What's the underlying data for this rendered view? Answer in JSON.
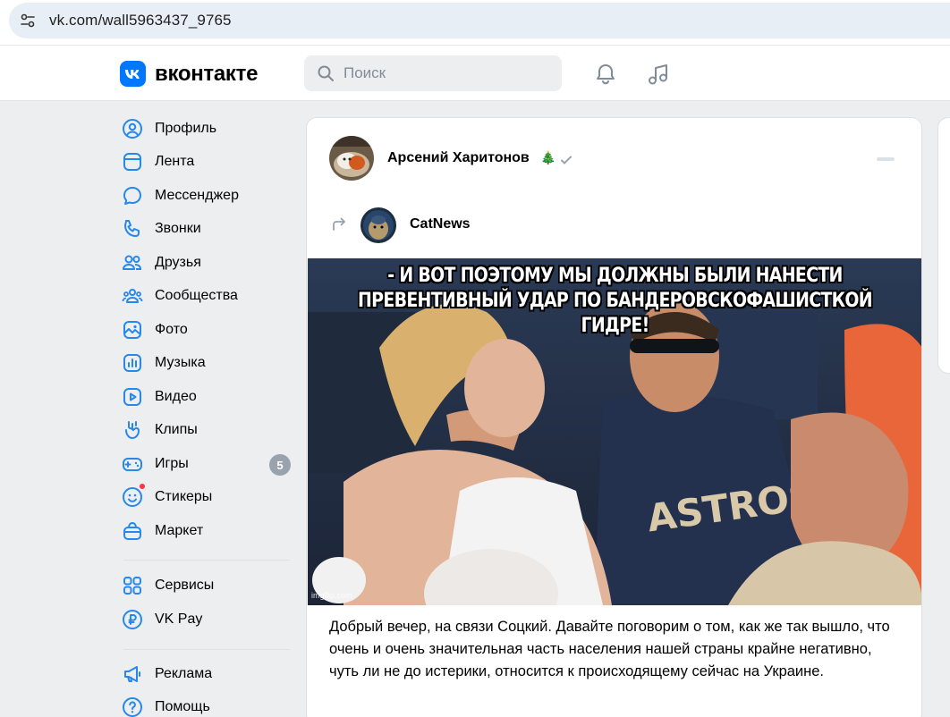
{
  "browser": {
    "url": "vk.com/wall5963437_9765"
  },
  "header": {
    "logo_letter": "VK",
    "wordmark": "вконтакте",
    "search_placeholder": "Поиск"
  },
  "nav": {
    "items": [
      {
        "label": "Профиль",
        "icon": "profile-icon"
      },
      {
        "label": "Лента",
        "icon": "feed-icon"
      },
      {
        "label": "Мессенджер",
        "icon": "messenger-icon"
      },
      {
        "label": "Звонки",
        "icon": "phone-icon"
      },
      {
        "label": "Друзья",
        "icon": "friends-icon"
      },
      {
        "label": "Сообщества",
        "icon": "communities-icon"
      },
      {
        "label": "Фото",
        "icon": "photo-icon"
      },
      {
        "label": "Музыка",
        "icon": "music-icon"
      },
      {
        "label": "Видео",
        "icon": "video-icon"
      },
      {
        "label": "Клипы",
        "icon": "clips-icon"
      },
      {
        "label": "Игры",
        "icon": "games-icon",
        "badge": "5"
      },
      {
        "label": "Стикеры",
        "icon": "stickers-icon"
      },
      {
        "label": "Маркет",
        "icon": "market-icon"
      },
      {
        "label": "Сервисы",
        "icon": "services-icon"
      },
      {
        "label": "VK Pay",
        "icon": "vkpay-icon"
      },
      {
        "label": "Реклама",
        "icon": "ads-icon"
      },
      {
        "label": "Помощь",
        "icon": "help-icon"
      }
    ]
  },
  "post": {
    "author_name": "Арсений Харитонов",
    "author_badge": "🎄",
    "source_name": "CatNews",
    "meme_caption_line1": "- И ВОТ ПОЭТОМУ МЫ ДОЛЖНЫ БЫЛИ НАНЕСТИ",
    "meme_caption_line2": "ПРЕВЕНТИВНЫЙ УДАР ПО БАНДЕРОВСКОФАШИСТКОЙ ГИДРЕ!",
    "watermark": "imgflip.com",
    "text": "Добрый вечер, на связи Соцкий. Давайте поговорим о том, как же так вышло, что очень и очень значительная часть населения нашей страны крайне негативно, чуть ли не до истерики, относится к происходящему сейчас на Украине."
  },
  "colors": {
    "accent": "#0077ff",
    "page_bg": "#edeef0",
    "icon": "#2688eb",
    "badge": "#99a2ad",
    "dot": "#ff3347"
  }
}
